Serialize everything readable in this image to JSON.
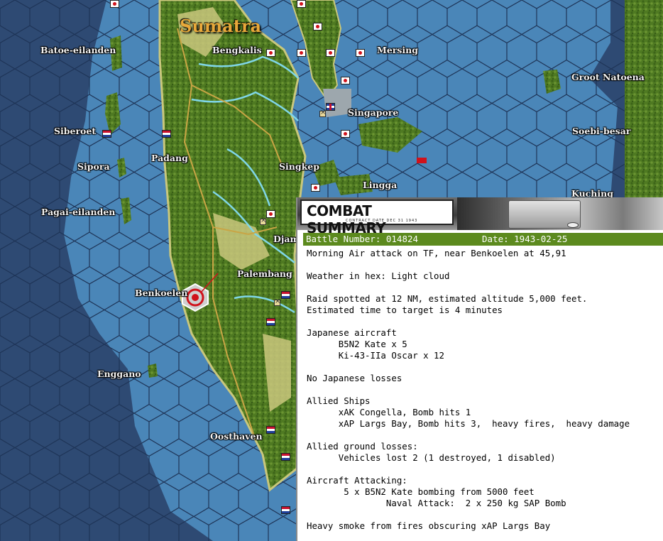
{
  "map": {
    "colors": {
      "deep_sea": "#2e4a73",
      "shallow_sea": "#4a86b8",
      "land": "#4f7a22",
      "coast_plain": "#c9c77c",
      "river": "#7fd6e8",
      "road": "#c9a545"
    },
    "labels": {
      "sumatra": "Sumatra",
      "batoe": "Batoe-eilanden",
      "bengkalis": "Bengkalis",
      "mersing": "Mersing",
      "groot_natoena": "Groot Natoena",
      "singapore": "Singapore",
      "siberoet": "Siberoet",
      "soebi_besar": "Soebi-besar",
      "padang": "Padang",
      "sipora": "Sipora",
      "singkep": "Singkep",
      "lingga": "Lingga",
      "kuching": "Kuching",
      "pagai": "Pagai-eilanden",
      "djambi": "Djam",
      "palembang": "Palembang",
      "benkoelen": "Benkoelen",
      "enggano": "Enggano",
      "oosthaven": "Oosthaven"
    }
  },
  "panel": {
    "title": "COMBAT SUMMARY",
    "subtitle": "CONTRACT DATE DEC 31 1943",
    "battle_number": "Battle Number: 014824",
    "date": "Date: 1943-02-25",
    "lines": [
      "Morning Air attack on TF, near Benkoelen at 45,91",
      "",
      "Weather in hex: Light cloud",
      "",
      "Raid spotted at 12 NM, estimated altitude 5,000 feet.",
      "Estimated time to target is 4 minutes",
      "",
      "Japanese aircraft",
      "      B5N2 Kate x 5",
      "      Ki-43-IIa Oscar x 12",
      "",
      "No Japanese losses",
      "",
      "Allied Ships",
      "      xAK Congella, Bomb hits 1",
      "      xAP Largs Bay, Bomb hits 3,  heavy fires,  heavy damage",
      "",
      "Allied ground losses:",
      "      Vehicles lost 2 (1 destroyed, 1 disabled)",
      "",
      "Aircraft Attacking:",
      "       5 x B5N2 Kate bombing from 5000 feet",
      "               Naval Attack:  2 x 250 kg SAP Bomb",
      "",
      "Heavy smoke from fires obscuring xAP Largs Bay"
    ]
  }
}
